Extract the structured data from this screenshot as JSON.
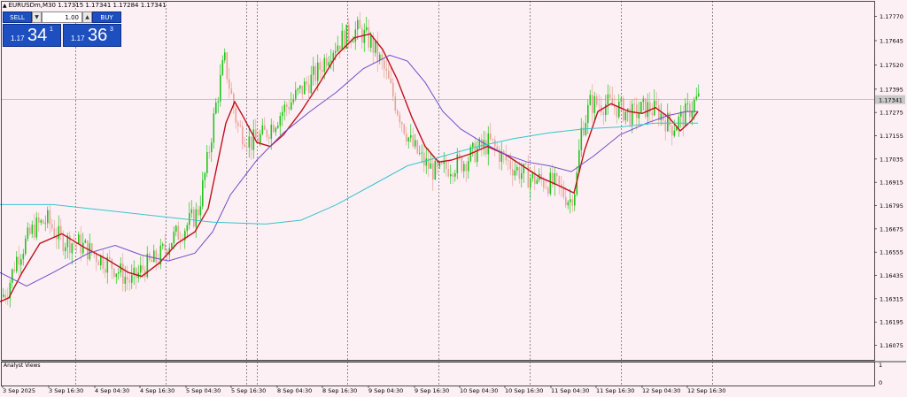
{
  "header": {
    "symbol_line": "EURUSDm,M30  1.17315 1.17341 1.17284 1.17341"
  },
  "trade_panel": {
    "sell_label": "SELL",
    "buy_label": "BUY",
    "lot_value": "1.00",
    "spin_down": "▼",
    "spin_up": "▲",
    "bid": {
      "small": "1.17",
      "big": "34",
      "sup": "1"
    },
    "ask": {
      "small": "1.17",
      "big": "36",
      "sup": "3"
    }
  },
  "indicator_panel": {
    "label": "Analyst Views",
    "scale_top": "1",
    "scale_bottom": "0"
  },
  "colors": {
    "background": "#fdf0f5",
    "candle_up": "#22c31a",
    "candle_down": "#e8a39a",
    "ma_fast": "#c0101a",
    "ma_mid": "#6a4fc8",
    "ma_slow": "#39c4cc",
    "button_blue": "#1e4fc0"
  },
  "chart_data": {
    "type": "line",
    "symbol": "EURUSDm",
    "timeframe": "M30",
    "current_price": "1.17341",
    "ylim": [
      1.16,
      1.1785
    ],
    "y_ticks": [
      "1.17770",
      "1.17645",
      "1.17520",
      "1.17395",
      "1.17275",
      "1.17155",
      "1.17035",
      "1.16915",
      "1.16795",
      "1.16675",
      "1.16555",
      "1.16435",
      "1.16315",
      "1.16195",
      "1.16075"
    ],
    "x_ticks": [
      "3 Sep 2025",
      "3 Sep 16:30",
      "4 Sep 04:30",
      "4 Sep 16:30",
      "5 Sep 04:30",
      "5 Sep 16:30",
      "8 Sep 04:30",
      "8 Sep 16:30",
      "9 Sep 04:30",
      "9 Sep 16:30",
      "10 Sep 04:30",
      "10 Sep 16:30",
      "11 Sep 04:30",
      "11 Sep 16:30",
      "12 Sep 04:30",
      "12 Sep 16:30"
    ],
    "day_separators": [
      "3 Sep 16:30",
      "4 Sep 16:30",
      "5 Sep 16:30",
      "5 Sep 19:00",
      "8 Sep 16:30",
      "9 Sep 16:30",
      "10 Sep 16:30",
      "11 Sep 16:30",
      "12 Sep 16:30"
    ],
    "price_path": [
      [
        0,
        1.1631
      ],
      [
        10,
        1.1636
      ],
      [
        20,
        1.1652
      ],
      [
        40,
        1.1668
      ],
      [
        55,
        1.1672
      ],
      [
        70,
        1.1662
      ],
      [
        90,
        1.166
      ],
      [
        110,
        1.1654
      ],
      [
        130,
        1.1648
      ],
      [
        150,
        1.164
      ],
      [
        165,
        1.1648
      ],
      [
        180,
        1.1652
      ],
      [
        195,
        1.1662
      ],
      [
        210,
        1.1668
      ],
      [
        225,
        1.1676
      ],
      [
        235,
        1.17
      ],
      [
        245,
        1.173
      ],
      [
        255,
        1.1755
      ],
      [
        262,
        1.1738
      ],
      [
        270,
        1.172
      ],
      [
        285,
        1.1712
      ],
      [
        300,
        1.1716
      ],
      [
        320,
        1.1728
      ],
      [
        340,
        1.1738
      ],
      [
        360,
        1.1748
      ],
      [
        375,
        1.176
      ],
      [
        390,
        1.1766
      ],
      [
        405,
        1.177
      ],
      [
        420,
        1.1764
      ],
      [
        435,
        1.175
      ],
      [
        450,
        1.173
      ],
      [
        465,
        1.1712
      ],
      [
        480,
        1.1702
      ],
      [
        495,
        1.1696
      ],
      [
        510,
        1.17
      ],
      [
        525,
        1.1702
      ],
      [
        540,
        1.1708
      ],
      [
        555,
        1.1712
      ],
      [
        570,
        1.1704
      ],
      [
        585,
        1.1698
      ],
      [
        600,
        1.1694
      ],
      [
        615,
        1.1692
      ],
      [
        630,
        1.169
      ],
      [
        645,
        1.1682
      ],
      [
        652,
        1.169
      ],
      [
        658,
        1.1718
      ],
      [
        668,
        1.1732
      ],
      [
        685,
        1.1732
      ],
      [
        700,
        1.173
      ],
      [
        715,
        1.1726
      ],
      [
        730,
        1.173
      ],
      [
        745,
        1.1728
      ],
      [
        760,
        1.172
      ],
      [
        775,
        1.1726
      ],
      [
        788,
        1.1734
      ]
    ],
    "series": [
      {
        "name": "",
        "color": "#c0101a",
        "points": [
          [
            0,
            1.163
          ],
          [
            10,
            1.1632
          ],
          [
            25,
            1.1645
          ],
          [
            45,
            1.166
          ],
          [
            70,
            1.1665
          ],
          [
            95,
            1.1658
          ],
          [
            120,
            1.1652
          ],
          [
            145,
            1.1645
          ],
          [
            160,
            1.1643
          ],
          [
            180,
            1.165
          ],
          [
            200,
            1.166
          ],
          [
            220,
            1.1666
          ],
          [
            235,
            1.1678
          ],
          [
            245,
            1.17
          ],
          [
            255,
            1.1722
          ],
          [
            265,
            1.1733
          ],
          [
            275,
            1.1725
          ],
          [
            290,
            1.1712
          ],
          [
            305,
            1.171
          ],
          [
            320,
            1.1716
          ],
          [
            340,
            1.1728
          ],
          [
            360,
            1.1742
          ],
          [
            380,
            1.1757
          ],
          [
            400,
            1.1766
          ],
          [
            418,
            1.1768
          ],
          [
            432,
            1.176
          ],
          [
            448,
            1.1745
          ],
          [
            465,
            1.1725
          ],
          [
            480,
            1.171
          ],
          [
            495,
            1.1702
          ],
          [
            510,
            1.1703
          ],
          [
            530,
            1.1706
          ],
          [
            550,
            1.171
          ],
          [
            570,
            1.1706
          ],
          [
            590,
            1.17
          ],
          [
            610,
            1.1694
          ],
          [
            630,
            1.169
          ],
          [
            648,
            1.1686
          ],
          [
            660,
            1.1708
          ],
          [
            675,
            1.1728
          ],
          [
            690,
            1.1732
          ],
          [
            710,
            1.1728
          ],
          [
            725,
            1.1727
          ],
          [
            740,
            1.173
          ],
          [
            755,
            1.1725
          ],
          [
            768,
            1.1718
          ],
          [
            780,
            1.1723
          ],
          [
            788,
            1.1728
          ]
        ]
      },
      {
        "name": "",
        "color": "#6a4fc8",
        "points": [
          [
            0,
            1.1645
          ],
          [
            30,
            1.1638
          ],
          [
            60,
            1.1645
          ],
          [
            100,
            1.1655
          ],
          [
            130,
            1.1659
          ],
          [
            160,
            1.1654
          ],
          [
            190,
            1.1651
          ],
          [
            220,
            1.1655
          ],
          [
            240,
            1.1666
          ],
          [
            260,
            1.1685
          ],
          [
            290,
            1.1703
          ],
          [
            320,
            1.1717
          ],
          [
            350,
            1.1728
          ],
          [
            380,
            1.1738
          ],
          [
            410,
            1.175
          ],
          [
            440,
            1.1757
          ],
          [
            460,
            1.1754
          ],
          [
            480,
            1.1743
          ],
          [
            500,
            1.1728
          ],
          [
            520,
            1.1719
          ],
          [
            545,
            1.1712
          ],
          [
            570,
            1.1706
          ],
          [
            595,
            1.1702
          ],
          [
            620,
            1.17
          ],
          [
            645,
            1.1697
          ],
          [
            670,
            1.1705
          ],
          [
            700,
            1.1716
          ],
          [
            730,
            1.1722
          ],
          [
            755,
            1.1726
          ],
          [
            775,
            1.1728
          ],
          [
            788,
            1.1728
          ]
        ]
      },
      {
        "name": "",
        "color": "#39c4cc",
        "points": [
          [
            0,
            1.168
          ],
          [
            60,
            1.168
          ],
          [
            120,
            1.1677
          ],
          [
            180,
            1.1674
          ],
          [
            240,
            1.1671
          ],
          [
            300,
            1.167
          ],
          [
            340,
            1.1672
          ],
          [
            380,
            1.168
          ],
          [
            420,
            1.169
          ],
          [
            460,
            1.17
          ],
          [
            500,
            1.1705
          ],
          [
            540,
            1.171
          ],
          [
            580,
            1.1714
          ],
          [
            620,
            1.1717
          ],
          [
            660,
            1.1719
          ],
          [
            700,
            1.172
          ],
          [
            740,
            1.1722
          ],
          [
            788,
            1.1722
          ]
        ]
      }
    ]
  }
}
